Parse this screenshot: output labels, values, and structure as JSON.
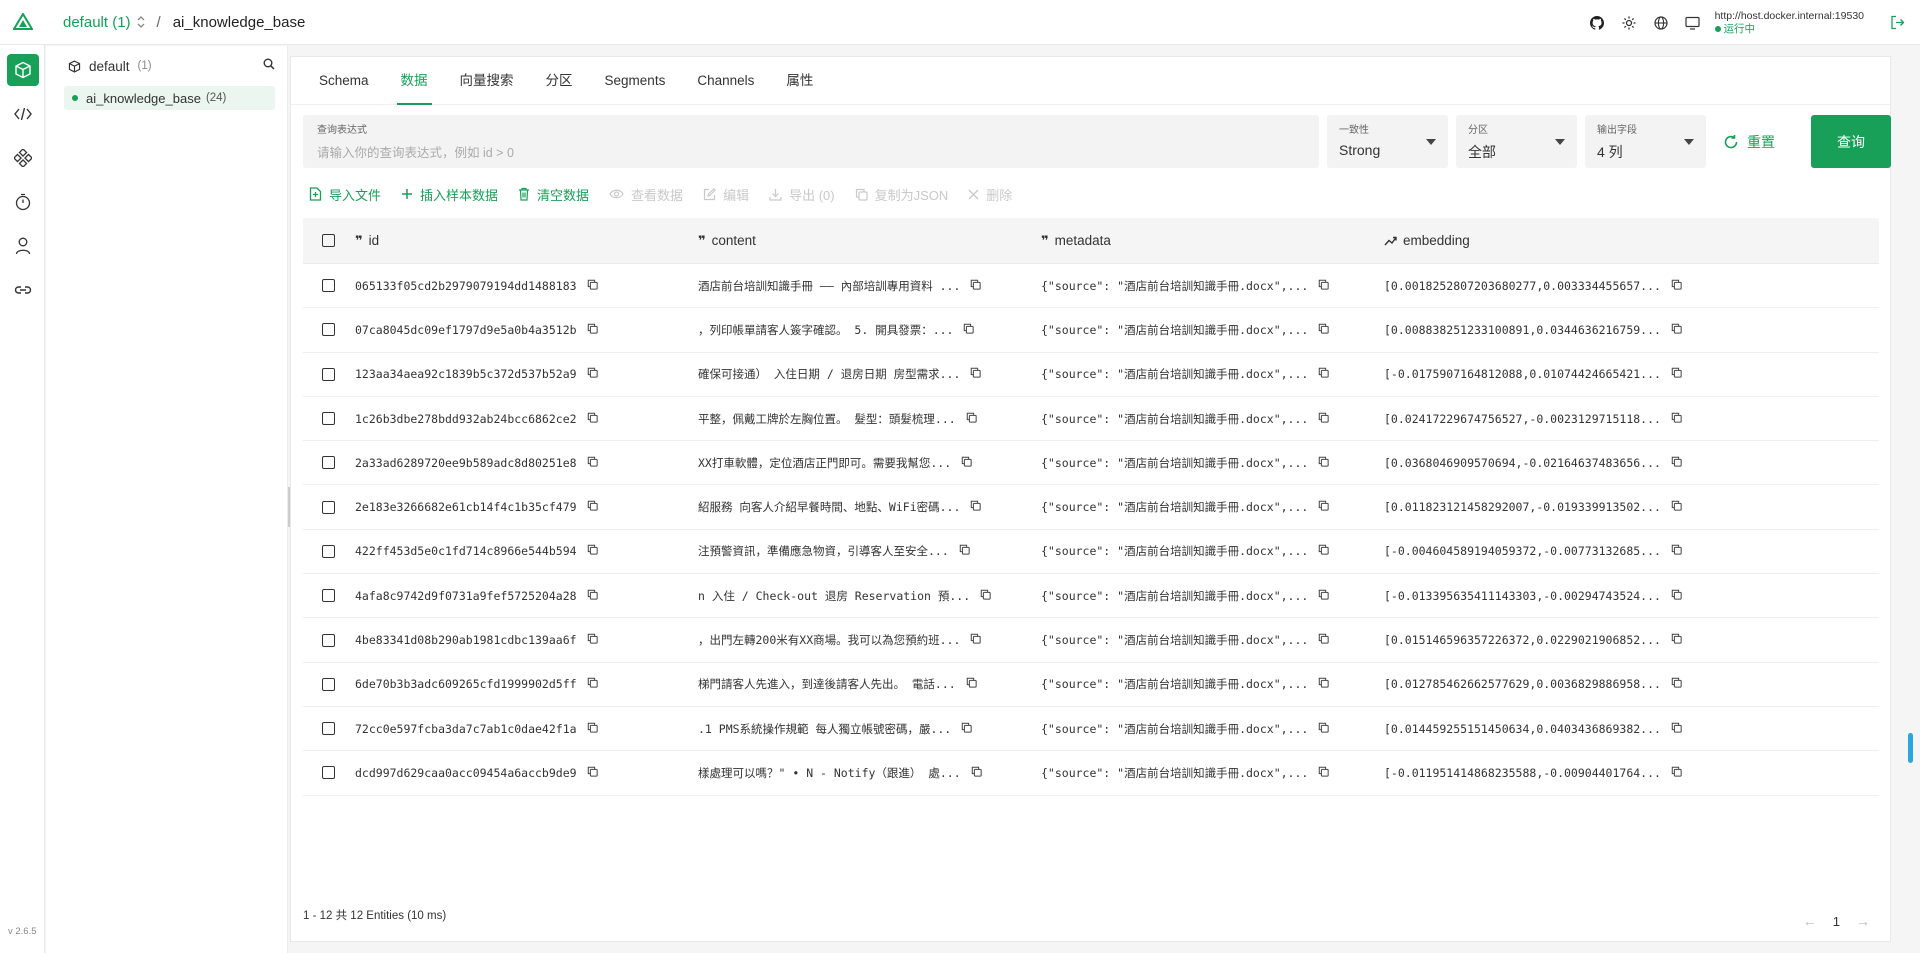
{
  "header": {
    "database": "default (1)",
    "separator": "/",
    "collection": "ai_knowledge_base",
    "connection_url": "http://host.docker.internal:19530",
    "connection_status": "运行中"
  },
  "rail": {
    "version": "v 2.6.5"
  },
  "tree": {
    "db_name": "default",
    "db_count": "(1)",
    "collection_name": "ai_knowledge_base",
    "collection_count": "(24)"
  },
  "tabs": [
    "Schema",
    "数据",
    "向量搜索",
    "分区",
    "Segments",
    "Channels",
    "属性"
  ],
  "query": {
    "expr_label": "查询表达式",
    "expr_placeholder": "请输入你的查询表达式，例如 id > 0",
    "consistency_label": "一致性",
    "consistency_value": "Strong",
    "partition_label": "分区",
    "partition_value": "全部",
    "output_label": "输出字段",
    "output_value": "4 列",
    "reset_label": "重置",
    "query_label": "查询"
  },
  "actions": {
    "import": "导入文件",
    "insert_sample": "插入样本数据",
    "clear": "清空数据",
    "view": "查看数据",
    "edit": "编辑",
    "export": "导出 (0)",
    "copy_json": "复制为JSON",
    "delete": "删除"
  },
  "table": {
    "columns": [
      "id",
      "content",
      "metadata",
      "embedding"
    ],
    "rows": [
      {
        "id": "065133f05cd2b2979079194dd1488183",
        "content": "酒店前台培訓知識手冊 —— 內部培訓專用資料 ...",
        "metadata": "{\"source\": \"酒店前台培訓知識手冊.docx\",...",
        "embedding": "[0.0018252807203680277,0.003334455657..."
      },
      {
        "id": "07ca8045dc09ef1797d9e5a0b4a3512b",
        "content": "，列印帳單請客人簽字確認。 5. 開具發票：...",
        "metadata": "{\"source\": \"酒店前台培訓知識手冊.docx\",...",
        "embedding": "[0.008838251233100891,0.0344636216759..."
      },
      {
        "id": "123aa34aea92c1839b5c372d537b52a9",
        "content": "確保可接通） 入住日期 / 退房日期 房型需求...",
        "metadata": "{\"source\": \"酒店前台培訓知識手冊.docx\",...",
        "embedding": "[-0.0175907164812088,0.01074424665421..."
      },
      {
        "id": "1c26b3dbe278bdd932ab24bcc6862ce2",
        "content": "平整，佩戴工牌於左胸位置。 髮型：頭髮梳理...",
        "metadata": "{\"source\": \"酒店前台培訓知識手冊.docx\",...",
        "embedding": "[0.02417229674756527,-0.0023129715118..."
      },
      {
        "id": "2a33ad6289720ee9b589adc8d80251e8",
        "content": "XX打車軟體，定位酒店正門即可。需要我幫您...",
        "metadata": "{\"source\": \"酒店前台培訓知識手冊.docx\",...",
        "embedding": "[0.0368046909570694,-0.02164637483656..."
      },
      {
        "id": "2e183e3266682e61cb14f4c1b35cf479",
        "content": "紹服務 向客人介紹早餐時間、地點、WiFi密碼...",
        "metadata": "{\"source\": \"酒店前台培訓知識手冊.docx\",...",
        "embedding": "[0.011823121458292007,-0.019339913502..."
      },
      {
        "id": "422ff453d5e0c1fd714c8966e544b594",
        "content": "注預警資訊，準備應急物資，引導客人至安全...",
        "metadata": "{\"source\": \"酒店前台培訓知識手冊.docx\",...",
        "embedding": "[-0.004604589194059372,-0.00773132685..."
      },
      {
        "id": "4afa8c9742d9f0731a9fef5725204a28",
        "content": "n 入住 / Check-out 退房 Reservation 預...",
        "metadata": "{\"source\": \"酒店前台培訓知識手冊.docx\",...",
        "embedding": "[-0.013395635411143303,-0.00294743524..."
      },
      {
        "id": "4be83341d08b290ab1981cdbc139aa6f",
        "content": "，出門左轉200米有XX商場。我可以為您預約班...",
        "metadata": "{\"source\": \"酒店前台培訓知識手冊.docx\",...",
        "embedding": "[0.015146596357226372,0.0229021906852..."
      },
      {
        "id": "6de70b3b3adc609265cfd1999902d5ff",
        "content": "梯門請客人先進入，到達後請客人先出。 電話...",
        "metadata": "{\"source\": \"酒店前台培訓知識手冊.docx\",...",
        "embedding": "[0.012785462662577629,0.0036829886958..."
      },
      {
        "id": "72cc0e597fcba3da7c7ab1c0dae42f1a",
        "content": ".1 PMS系統操作規範 每人獨立帳號密碼，嚴...",
        "metadata": "{\"source\": \"酒店前台培訓知識手冊.docx\",...",
        "embedding": "[0.014459255151450634,0.0403436869382..."
      },
      {
        "id": "dcd997d629caa0acc09454a6accb9de9",
        "content": "樣處理可以嗎？\" • N - Notify（跟進） 處...",
        "metadata": "{\"source\": \"酒店前台培訓知識手冊.docx\",...",
        "embedding": "[-0.011951414868235588,-0.00904401764..."
      }
    ]
  },
  "footer": {
    "summary": "1 - 12 共 12 Entities (10 ms)",
    "page": "1"
  }
}
